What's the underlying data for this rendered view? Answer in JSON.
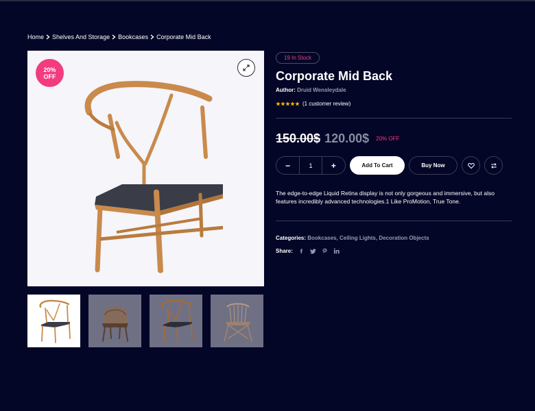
{
  "breadcrumb": {
    "items": [
      "Home",
      "Shelves And Storage",
      "Bookcases",
      "Corporate Mid Back"
    ]
  },
  "gallery": {
    "sale_badge": {
      "line1": "20%",
      "line2": "OFF"
    },
    "zoom_icon": "expand-icon",
    "thumbnails": [
      "wishbone-chair-natural",
      "rattan-chair-dark",
      "wishbone-chair-dark",
      "spindle-chair-grey"
    ]
  },
  "product": {
    "stock": "19 In Stock",
    "title": "Corporate Mid Back",
    "author_label": "Author:",
    "author_name": "Druid Wensleydale",
    "rating": {
      "stars": 5,
      "max": 5,
      "review_text": "(1 customer review)"
    },
    "old_price": "150.00$",
    "new_price": "120.00$",
    "discount": "20% OFF",
    "quantity": "1",
    "qty_minus": "−",
    "qty_plus": "+",
    "add_to_cart": "Add To Cart",
    "buy_now": "Buy Now",
    "description": "The edge-to-edge Liquid Retina display is not only gorgeous and immersive, but also features incredibly advanced technologies.1 Like ProMotion, True Tone.",
    "categories_label": "Categories:",
    "categories": [
      "Bookcases",
      "Ceiling Lights",
      "Decoration Objects"
    ],
    "share_label": "Share:",
    "share_icons": [
      "facebook-icon",
      "twitter-icon",
      "pinterest-icon",
      "linkedin-icon"
    ]
  },
  "colors": {
    "background": "#040627",
    "accent_pink": "#f33b7f",
    "muted_text": "#9899ad",
    "border": "#3b3d55"
  }
}
